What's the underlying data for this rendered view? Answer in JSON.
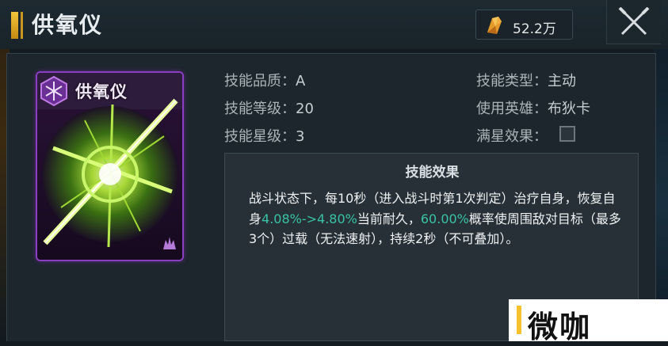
{
  "header": {
    "title": "供氧仪",
    "currency_amount": "52.2万",
    "currency_icon": "crystal-icon",
    "close_icon": "close-icon"
  },
  "card": {
    "name": "供氧仪",
    "type_icon": "hexagon-skill-icon",
    "rank_icon": "rank-icon"
  },
  "stats": {
    "quality_label": "技能品质：",
    "quality_value": "A",
    "level_label": "技能等级：",
    "level_value": "20",
    "star_label": "技能星级：",
    "star_value": "3",
    "type_label": "技能类型：",
    "type_value": "主动",
    "hero_label": "使用英雄：",
    "hero_value": "布狄卡",
    "max_star_label": "满星效果：",
    "max_star_checked": false
  },
  "effect": {
    "title": "技能效果",
    "text_1": "战斗状态下，每10秒（进入战斗时第1次判定）治疗自身，恢复自身",
    "highlight_1": "4.08%->4.80%",
    "text_2": "当前耐久，",
    "highlight_2": "60.00%",
    "text_3": "概率使周围敌对目标（最多3个）过载（无法速射），持续2秒（不可叠加）。",
    "highlight_color": "#39c3a6"
  },
  "watermark": {
    "text": "微咖"
  }
}
